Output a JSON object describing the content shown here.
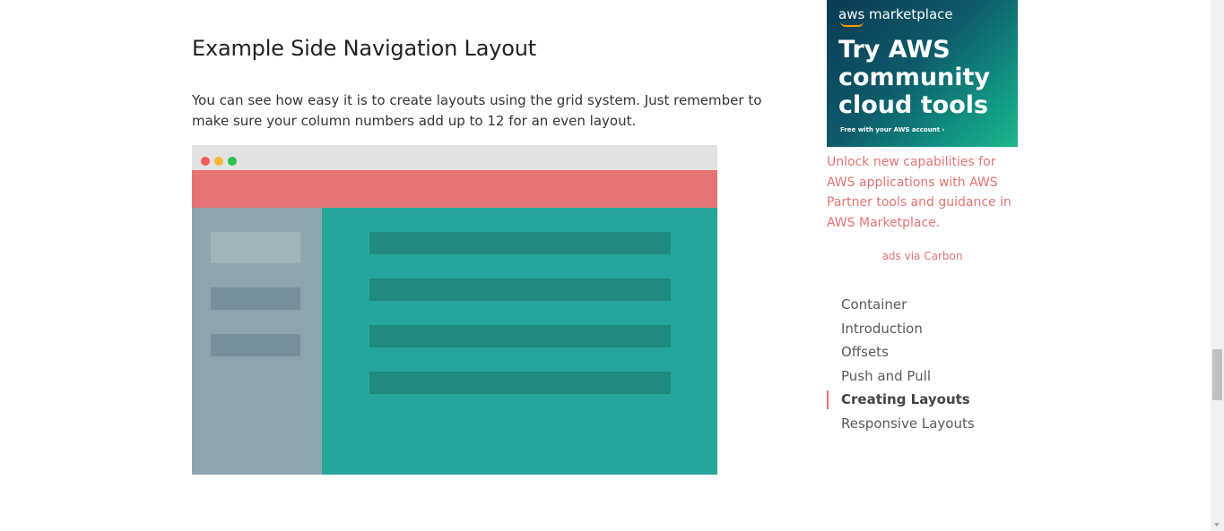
{
  "section": {
    "title": "Example Side Navigation Layout",
    "description": "You can see how easy it is to create layouts using the grid system. Just remember to make sure your column numbers add up to 12 for an even layout."
  },
  "ad": {
    "brand": "aws marketplace",
    "headline": "Try AWS community cloud tools",
    "subline": "Free with your AWS account ›",
    "text": "Unlock new capabilities for AWS applications with AWS Partner tools and guidance in AWS Marketplace.",
    "via": "ads via Carbon"
  },
  "toc": {
    "items": [
      {
        "label": "Container",
        "active": false
      },
      {
        "label": "Introduction",
        "active": false
      },
      {
        "label": "Offsets",
        "active": false
      },
      {
        "label": "Push and Pull",
        "active": false
      },
      {
        "label": "Creating Layouts",
        "active": true
      },
      {
        "label": "Responsive Layouts",
        "active": false
      }
    ]
  },
  "colors": {
    "accent": "#e57373",
    "teal": "#26a69a",
    "slate": "#90a4ae"
  }
}
